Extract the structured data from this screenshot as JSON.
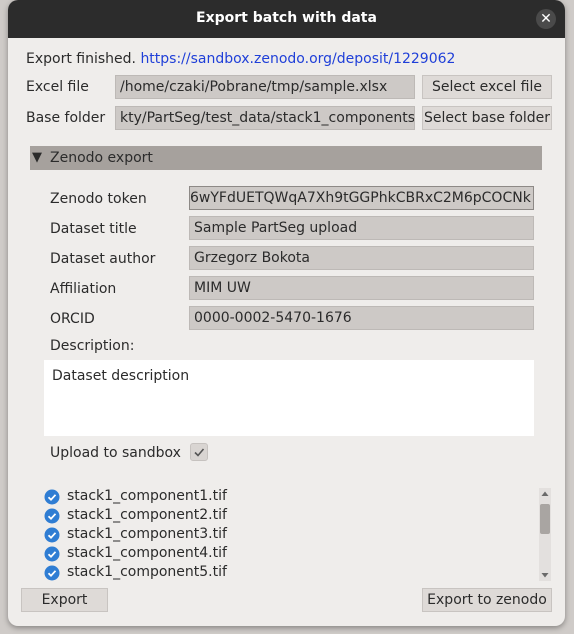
{
  "window": {
    "title": "Export batch with data",
    "close_glyph": "✕"
  },
  "status": {
    "text": "Export finished.",
    "url": "https://sandbox.zenodo.org/deposit/1229062"
  },
  "excel": {
    "label": "Excel file",
    "value": "/home/czaki/Pobrane/tmp/sample.xlsx",
    "button": "Select excel file"
  },
  "base": {
    "label": "Base folder",
    "value": "kty/PartSeg/test_data/stack1_components",
    "button": "Select base folder"
  },
  "section": {
    "arrow": "▼",
    "title": "Zenodo export"
  },
  "form": {
    "token_label": "Zenodo token",
    "token_value": "6wYFdUETQWqA7Xh9tGGPhkCBRxC2M6pCOCNk",
    "title_label": "Dataset title",
    "title_value": "Sample PartSeg upload",
    "author_label": "Dataset author",
    "author_value": "Grzegorz Bokota",
    "affiliation_label": "Affiliation",
    "affiliation_value": "MIM UW",
    "orcid_label": "ORCID",
    "orcid_value": "0000-0002-5470-1676",
    "description_label": "Description:",
    "description_value": "Dataset description",
    "sandbox_label": "Upload to sandbox",
    "sandbox_checked": true
  },
  "files": [
    "stack1_component1.tif",
    "stack1_component2.tif",
    "stack1_component3.tif",
    "stack1_component4.tif",
    "stack1_component5.tif"
  ],
  "buttons": {
    "export": "Export",
    "export_zenodo": "Export to zenodo"
  },
  "colors": {
    "accent": "#1f3fd8",
    "check_blue": "#2f7dd3",
    "titlebar": "#2c2c2c"
  }
}
